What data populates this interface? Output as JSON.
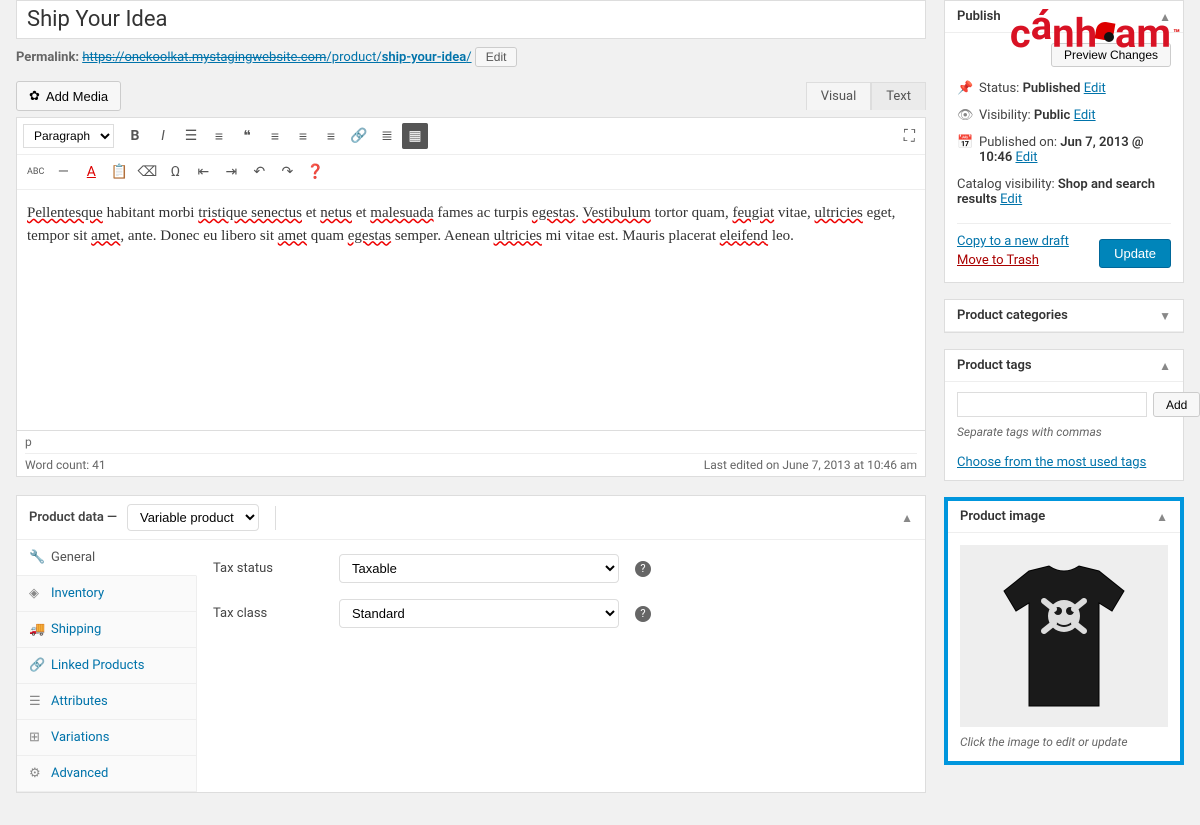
{
  "title": "Ship Your Idea",
  "permalink": {
    "label": "Permalink:",
    "base_strike": "https://onekoolkat.mystagingwebsite.com",
    "path": "/product/",
    "slug": "ship-your-idea",
    "edit_label": "Edit"
  },
  "add_media_label": "Add Media",
  "editor_tabs": {
    "visual": "Visual",
    "text": "Text"
  },
  "format_select": "Paragraph",
  "abc_label": "ABC",
  "content_html": "Pellentesque habitant morbi tristique senectus et netus et malesuada fames ac turpis egestas. Vestibulum tortor quam, feugiat vitae, ultricies eget, tempor sit amet, ante. Donec eu libero sit amet quam egestas semper. Aenean ultricies mi vitae est. Mauris placerat eleifend leo.",
  "p_tag": "p",
  "word_count_label": "Word count: 41",
  "last_edited": "Last edited on June 7, 2013 at 10:46 am",
  "product_data": {
    "header_label": "Product data —",
    "type_select": "Variable product",
    "tabs": [
      {
        "icon": "🔧",
        "label": "General",
        "active": true
      },
      {
        "icon": "◈",
        "label": "Inventory"
      },
      {
        "icon": "🚚",
        "label": "Shipping"
      },
      {
        "icon": "🔗",
        "label": "Linked Products"
      },
      {
        "icon": "☰",
        "label": "Attributes"
      },
      {
        "icon": "⊞",
        "label": "Variations"
      },
      {
        "icon": "⚙",
        "label": "Advanced"
      }
    ],
    "fields": {
      "tax_status_label": "Tax status",
      "tax_status_value": "Taxable",
      "tax_class_label": "Tax class",
      "tax_class_value": "Standard"
    }
  },
  "publish": {
    "header": "Publish",
    "preview_label": "Preview Changes",
    "status_label": "Status:",
    "status_value": "Published",
    "visibility_label": "Visibility:",
    "visibility_value": "Public",
    "published_on_label": "Published on:",
    "published_on_value": "Jun 7, 2013 @ 10:46",
    "catalog_label": "Catalog visibility:",
    "catalog_value": "Shop and search results",
    "edit": "Edit",
    "copy_draft": "Copy to a new draft",
    "trash": "Move to Trash",
    "update": "Update"
  },
  "categories": {
    "header": "Product categories"
  },
  "tags": {
    "header": "Product tags",
    "add_label": "Add",
    "help": "Separate tags with commas",
    "choose": "Choose from the most used tags"
  },
  "product_image": {
    "header": "Product image",
    "caption": "Click the image to edit or update"
  },
  "logo": {
    "text1": "c",
    "text2": "nh",
    "text3": "am",
    "tm": "™"
  }
}
